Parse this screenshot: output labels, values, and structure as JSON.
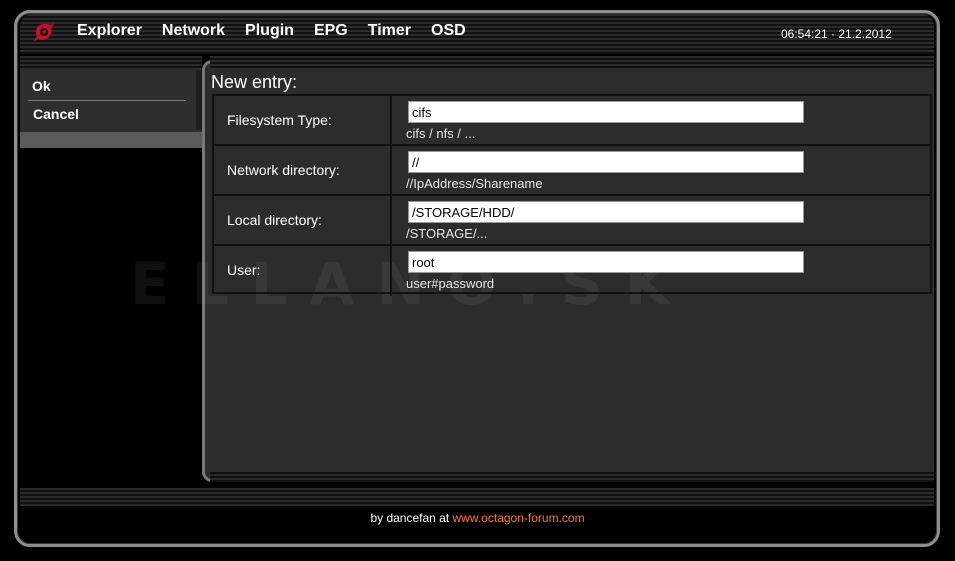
{
  "header": {
    "menu": [
      "Explorer",
      "Network",
      "Plugin",
      "EPG",
      "Timer",
      "OSD"
    ],
    "clock": "06:54:21 · 21.2.2012"
  },
  "sidebar": {
    "ok_label": "Ok",
    "cancel_label": "Cancel"
  },
  "main": {
    "title": "New entry:",
    "rows": [
      {
        "label": "Filesystem Type:",
        "value": "cifs",
        "hint": "cifs / nfs / ..."
      },
      {
        "label": "Network directory:",
        "value": "//",
        "hint": "//IpAddress/Sharename"
      },
      {
        "label": "Local directory:",
        "value": "/STORAGE/HDD/",
        "hint": "/STORAGE/..."
      },
      {
        "label": "User:",
        "value": "root",
        "hint": "user#password"
      }
    ]
  },
  "watermark": "ELLANO.SK",
  "footer": {
    "prefix": "by dancefan at",
    "link": "www.octagon-forum.com"
  },
  "colors": {
    "accent": "#ff7a1a",
    "logo": "#c8102e"
  }
}
